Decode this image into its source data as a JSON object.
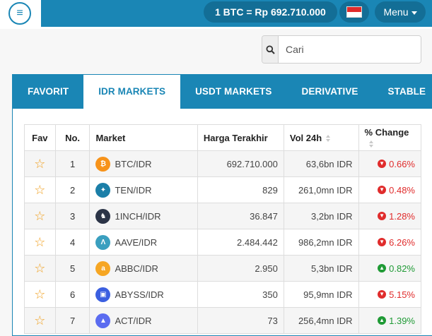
{
  "header": {
    "btc_price": "1 BTC = Rp 692.710.000",
    "menu_label": "Menu"
  },
  "search": {
    "placeholder": "Cari"
  },
  "tabs": [
    "FAVORIT",
    "IDR MARKETS",
    "USDT MARKETS",
    "DERIVATIVE",
    "STABLE"
  ],
  "active_tab": "IDR MARKETS",
  "table": {
    "headers": {
      "fav": "Fav",
      "no": "No.",
      "market": "Market",
      "last_price": "Harga Terakhir",
      "vol": "Vol 24h",
      "change": "% Change"
    },
    "rows": [
      {
        "no": "1",
        "market": "BTC/IDR",
        "price": "692.710.000",
        "vol": "63,6bn IDR",
        "change": "0.66%",
        "direction": "down",
        "icon": "bitcoin-icon",
        "icon_color": "#f7931a",
        "glyph": "₿"
      },
      {
        "no": "2",
        "market": "TEN/IDR",
        "price": "829",
        "vol": "261,0mn IDR",
        "change": "0.48%",
        "direction": "down",
        "icon": "tokenomy-icon",
        "icon_color": "#1b7fa8",
        "glyph": "✦"
      },
      {
        "no": "3",
        "market": "1INCH/IDR",
        "price": "36.847",
        "vol": "3,2bn IDR",
        "change": "1.28%",
        "direction": "down",
        "icon": "unicorn-icon",
        "icon_color": "#2b3447",
        "glyph": "♞"
      },
      {
        "no": "4",
        "market": "AAVE/IDR",
        "price": "2.484.442",
        "vol": "986,2mn IDR",
        "change": "6.26%",
        "direction": "down",
        "icon": "aave-icon",
        "icon_color": "#3a9fbf",
        "glyph": "Λ"
      },
      {
        "no": "5",
        "market": "ABBC/IDR",
        "price": "2.950",
        "vol": "5,3bn IDR",
        "change": "0.82%",
        "direction": "up",
        "icon": "abbc-icon",
        "icon_color": "#f6a623",
        "glyph": "a"
      },
      {
        "no": "6",
        "market": "ABYSS/IDR",
        "price": "350",
        "vol": "95,9mn IDR",
        "change": "5.15%",
        "direction": "down",
        "icon": "abyss-icon",
        "icon_color": "#3b5fe0",
        "glyph": "▣"
      },
      {
        "no": "7",
        "market": "ACT/IDR",
        "price": "73",
        "vol": "256,4mn IDR",
        "change": "1.39%",
        "direction": "up",
        "icon": "achain-icon",
        "icon_color": "#5b6cf0",
        "glyph": "▲"
      }
    ]
  },
  "colors": {
    "primary": "#1a86b5",
    "down": "#e02c2c",
    "up": "#1f9a35",
    "star": "#f0a020"
  }
}
